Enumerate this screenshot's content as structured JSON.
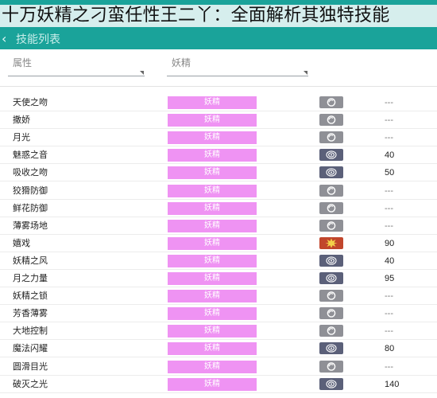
{
  "headline": "十万妖精之刁蛮任性王二丫：全面解析其独特技能",
  "appbar": {
    "back_glyph": "‹",
    "title": "技能列表"
  },
  "filters": {
    "type_label": "属性",
    "subtype_label": "妖精"
  },
  "colors": {
    "appbar": "#1aa39a",
    "fairy_type": "#ef93f3",
    "status": "#8f9096",
    "special": "#5b6079",
    "physical": "#c1462c"
  },
  "moves": [
    {
      "name": "天使之吻",
      "type": "妖精",
      "category": "status",
      "power": "---"
    },
    {
      "name": "撒娇",
      "type": "妖精",
      "category": "status",
      "power": "---"
    },
    {
      "name": "月光",
      "type": "妖精",
      "category": "status",
      "power": "---"
    },
    {
      "name": "魅惑之音",
      "type": "妖精",
      "category": "special",
      "power": "40"
    },
    {
      "name": "吸收之吻",
      "type": "妖精",
      "category": "special",
      "power": "50"
    },
    {
      "name": "狡猾防御",
      "type": "妖精",
      "category": "status",
      "power": "---"
    },
    {
      "name": "鲜花防御",
      "type": "妖精",
      "category": "status",
      "power": "---"
    },
    {
      "name": "薄雾场地",
      "type": "妖精",
      "category": "status",
      "power": "---"
    },
    {
      "name": "嬉戏",
      "type": "妖精",
      "category": "physical",
      "power": "90"
    },
    {
      "name": "妖精之风",
      "type": "妖精",
      "category": "special",
      "power": "40"
    },
    {
      "name": "月之力量",
      "type": "妖精",
      "category": "special",
      "power": "95"
    },
    {
      "name": "妖精之锁",
      "type": "妖精",
      "category": "status",
      "power": "---"
    },
    {
      "name": "芳香薄雾",
      "type": "妖精",
      "category": "status",
      "power": "---"
    },
    {
      "name": "大地控制",
      "type": "妖精",
      "category": "status",
      "power": "---"
    },
    {
      "name": "魔法闪耀",
      "type": "妖精",
      "category": "special",
      "power": "80"
    },
    {
      "name": "圆滑目光",
      "type": "妖精",
      "category": "status",
      "power": "---"
    },
    {
      "name": "破灭之光",
      "type": "妖精",
      "category": "special",
      "power": "140"
    }
  ]
}
